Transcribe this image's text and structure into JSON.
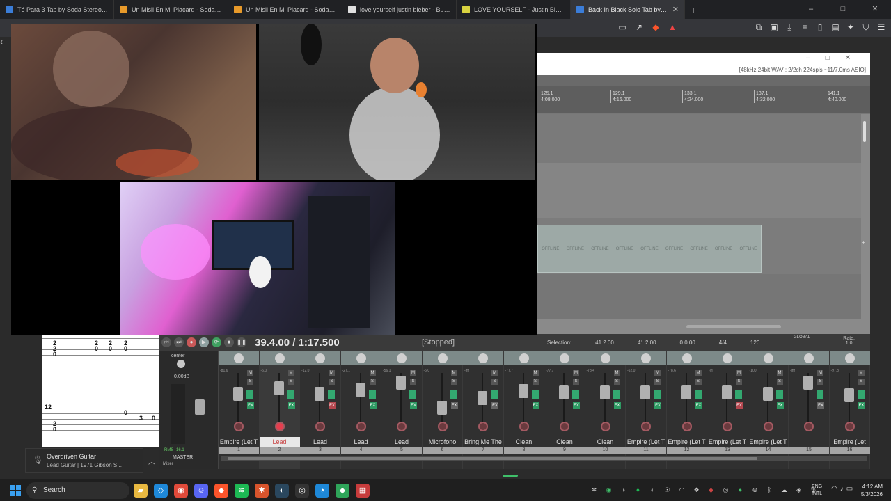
{
  "browser": {
    "tabs": [
      {
        "title": "Té Para 3 Tab by Soda Stereo | Songs",
        "color": "#3b7dd8",
        "active": false
      },
      {
        "title": "Un Misil En Mi Placard - Soda Stereo",
        "color": "#e89a2a",
        "active": false
      },
      {
        "title": "Un Misil En Mi Placard - Soda Stereo",
        "color": "#e89a2a",
        "active": false
      },
      {
        "title": "love yourself justin bieber - Buscar co",
        "color": "#e0e0e0",
        "active": false
      },
      {
        "title": "LOVE YOURSELF - Justin Bieber - LET",
        "color": "#d8d240",
        "active": false
      },
      {
        "title": "Back In Black Solo Tab by AC/DC",
        "color": "#3b7dd8",
        "active": true
      }
    ],
    "new_tab": "+",
    "window_controls": [
      "–",
      "□",
      "✕"
    ]
  },
  "daw": {
    "format_info": "[48kHz 24bit WAV : 2/2ch 224spls ~11/7.0ms ASIO]",
    "ruler": [
      {
        "bar": "125.1",
        "time": "4:08.000"
      },
      {
        "bar": "129.1",
        "time": "4:16.000"
      },
      {
        "bar": "133.1",
        "time": "4:24.000"
      },
      {
        "bar": "137.1",
        "time": "4:32.000"
      },
      {
        "bar": "141.1",
        "time": "4:40.000"
      }
    ],
    "offline_label": "OFFLINE",
    "position": "39.4.00 / 1:17.500",
    "state": "[Stopped]",
    "selection_label": "Selection:",
    "selection_start": "41.2.00",
    "selection_end": "41.2.00",
    "selection_len": "0.0.00",
    "time_sig": "4/4",
    "bpm": "120",
    "global_label": "GLOBAL",
    "rate_label": "Rate:",
    "rate_value": "1.0"
  },
  "master": {
    "center": "center",
    "db": "0.00dB",
    "rms": "RMS  -16.1",
    "label": "MASTER",
    "mixer_label": "Mixer"
  },
  "tracks": [
    {
      "name": "Empire (Let T",
      "num": "1",
      "vol": "-81.6"
    },
    {
      "name": "Lead",
      "num": "2",
      "vol": "-6.0",
      "selected": true
    },
    {
      "name": "Lead",
      "num": "3",
      "vol": "-12.0"
    },
    {
      "name": "Lead",
      "num": "4",
      "vol": "-27.1"
    },
    {
      "name": "Lead",
      "num": "5",
      "vol": "-56.1"
    },
    {
      "name": "Microfono",
      "num": "6",
      "vol": "-6.0"
    },
    {
      "name": "Bring Me The",
      "num": "7",
      "vol": "-inf"
    },
    {
      "name": "Clean",
      "num": "8",
      "vol": "-77.7"
    },
    {
      "name": "Clean",
      "num": "9",
      "vol": "-77.7"
    },
    {
      "name": "Clean",
      "num": "10",
      "vol": "-78.4"
    },
    {
      "name": "Empire (Let T",
      "num": "11",
      "vol": "-62.0"
    },
    {
      "name": "Empire (Let T",
      "num": "12",
      "vol": "-78.6"
    },
    {
      "name": "Empire (Let T",
      "num": "13",
      "vol": "-inf"
    },
    {
      "name": "Empire (Let T",
      "num": "14",
      "vol": "-100"
    },
    {
      "name": "",
      "num": "15",
      "vol": "-inf"
    },
    {
      "name": "Empire (Let",
      "num": "16",
      "vol": "-97.8"
    }
  ],
  "notification": {
    "title": "Overdriven Guitar",
    "subtitle": "Lead Guitar | 1971 Gibson S..."
  },
  "taskbar": {
    "search": "Search",
    "lang_top": "ENG",
    "lang_bottom": "INTL",
    "time": "4:12 AM",
    "date": "5/3/2026"
  }
}
